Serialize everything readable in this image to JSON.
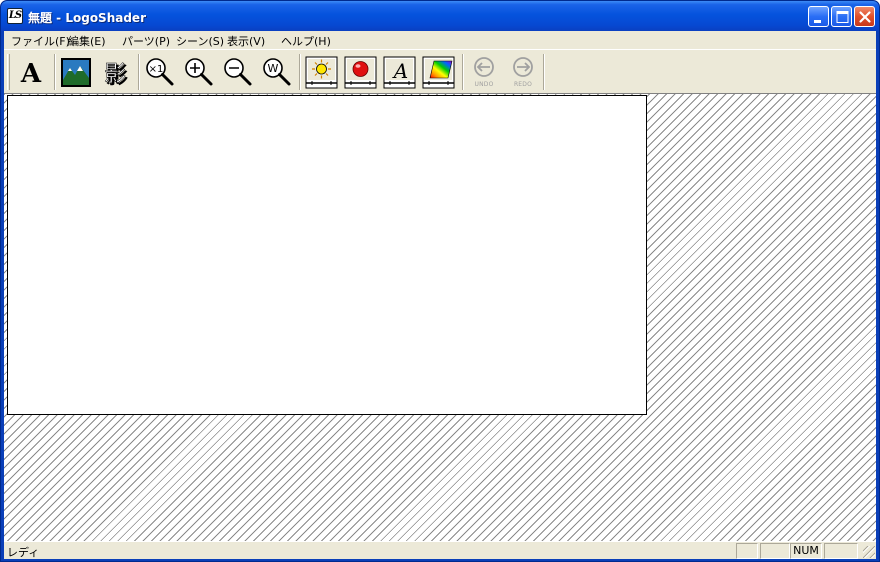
{
  "window": {
    "icon_text": "LS",
    "title": "無題 - LogoShader",
    "controls": {
      "minimize": "minimize",
      "maximize": "maximize",
      "close": "close"
    }
  },
  "menu": {
    "items": [
      {
        "label": "ファイル(F)"
      },
      {
        "label": "編集(E)"
      },
      {
        "label": "パーツ(P)"
      },
      {
        "label": "シーン(S)"
      },
      {
        "label": "表示(V)"
      },
      {
        "label": "ヘルプ(H)"
      }
    ]
  },
  "toolbar": {
    "text_tool": {
      "label": "A",
      "icon": "text-icon"
    },
    "background_tool": {
      "icon": "background-image-icon"
    },
    "shadow_tool": {
      "label": "影",
      "icon": "shadow-icon"
    },
    "zoom_x1": {
      "label": "×1",
      "icon": "zoom-actual-icon"
    },
    "zoom_in": {
      "icon": "zoom-in-icon"
    },
    "zoom_out": {
      "icon": "zoom-out-icon"
    },
    "zoom_window": {
      "label": "W",
      "icon": "zoom-fit-window-icon"
    },
    "light_tool": {
      "icon": "light-icon"
    },
    "material_tool": {
      "icon": "material-sphere-icon"
    },
    "font_tool": {
      "label": "A",
      "icon": "font-icon"
    },
    "color_tool": {
      "icon": "color-gradient-icon"
    },
    "undo": {
      "label": "UNDO",
      "enabled": false
    },
    "redo": {
      "label": "REDO",
      "enabled": false
    }
  },
  "statusbar": {
    "message": "レディ",
    "num_indicator": "NUM"
  },
  "colors": {
    "titlebar": "#0553dd",
    "chrome": "#ece9d8",
    "canvas": "#ffffff"
  }
}
